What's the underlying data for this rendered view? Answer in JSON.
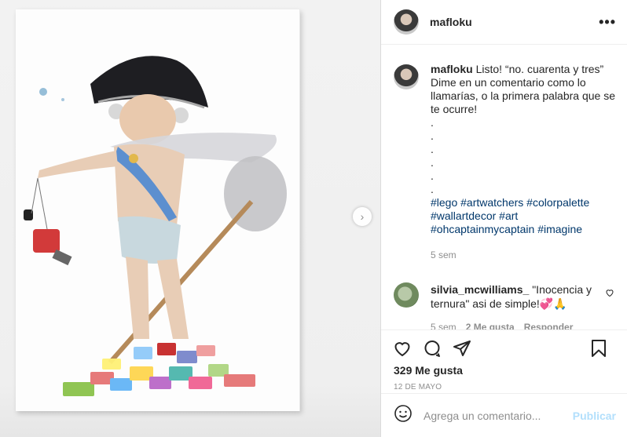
{
  "post": {
    "username": "mafloku",
    "more_label": "•••",
    "caption": {
      "username": "mafloku",
      "text": "Listo! “no. cuarenta y tres” Dime en un comentario como lo llamarías, o la primera palabra que se te ocurre!",
      "dots": [
        ".",
        ".",
        ".",
        ".",
        ".",
        "."
      ],
      "hashtags_line1": "#lego #artwatchers #colorpalette",
      "hashtags_line2": "#wallartdecor #art",
      "hashtags_line3": "#ohcaptainmycaptain #imagine",
      "time": "5 sem"
    },
    "reply": {
      "username": "silvia_mcwilliams_",
      "text": "\"Inocencia y ternura\" asi de simple!💞🙏",
      "time": "5 sem",
      "likes": "2 Me gusta",
      "reply_label": "Responder"
    },
    "likes": "329 Me gusta",
    "date": "12 DE MAYO",
    "comment_placeholder": "Agrega un comentario...",
    "publish_label": "Publicar",
    "icons": {
      "like": "heart-icon",
      "comment": "comment-icon",
      "share": "share-icon",
      "save": "bookmark-icon",
      "emoji": "emoji-icon",
      "next": "chevron-right-icon"
    }
  }
}
